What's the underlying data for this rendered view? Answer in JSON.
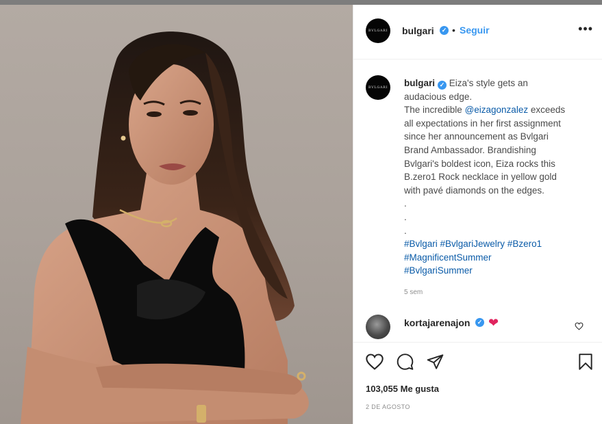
{
  "post": {
    "username": "bulgari",
    "verified_mark": "✓",
    "follow_separator": "•",
    "follow_label": "Seguir",
    "more_label": "•••",
    "avatar_text": "BVLGARI",
    "caption_lines": [
      {
        "type": "intro",
        "user": "bulgari",
        "text": " Eiza's style gets an"
      },
      {
        "type": "text",
        "text": "audacious edge."
      },
      {
        "type": "mention",
        "before": "The incredible ",
        "mention": "@eizagonzalez",
        "after": " exceeds"
      },
      {
        "type": "text",
        "text": "all expectations in her first assignment"
      },
      {
        "type": "text",
        "text": "since her announcement as Bvlgari"
      },
      {
        "type": "text",
        "text": "Brand Ambassador. Brandishing"
      },
      {
        "type": "text",
        "text": "Bvlgari's boldest icon, Eiza rocks this"
      },
      {
        "type": "text",
        "text": "B.zero1 Rock necklace in yellow gold"
      },
      {
        "type": "text",
        "text": "with pavé diamonds on the edges."
      },
      {
        "type": "text",
        "text": "."
      },
      {
        "type": "text",
        "text": "."
      },
      {
        "type": "text",
        "text": "."
      },
      {
        "type": "tags",
        "text": "#Bvlgari #BvlgariJewelry #Bzero1"
      },
      {
        "type": "tags",
        "text": "#MagnificentSummer"
      },
      {
        "type": "tags",
        "text": "#BvlgariSummer"
      }
    ],
    "age": "5 sem"
  },
  "comment": {
    "username": "kortajarenajon",
    "emoji": "❤"
  },
  "actions": {
    "like_icon": "heart-outline-icon",
    "comment_icon": "comment-bubble-icon",
    "share_icon": "paper-plane-icon",
    "save_icon": "bookmark-icon",
    "likes_count": "103,055",
    "likes_label": "Me gusta",
    "date": "2 DE AGOSTO"
  },
  "colors": {
    "link_blue": "#3897f0",
    "tag_blue": "#0a5ba8",
    "heart_red": "#e0245e"
  }
}
